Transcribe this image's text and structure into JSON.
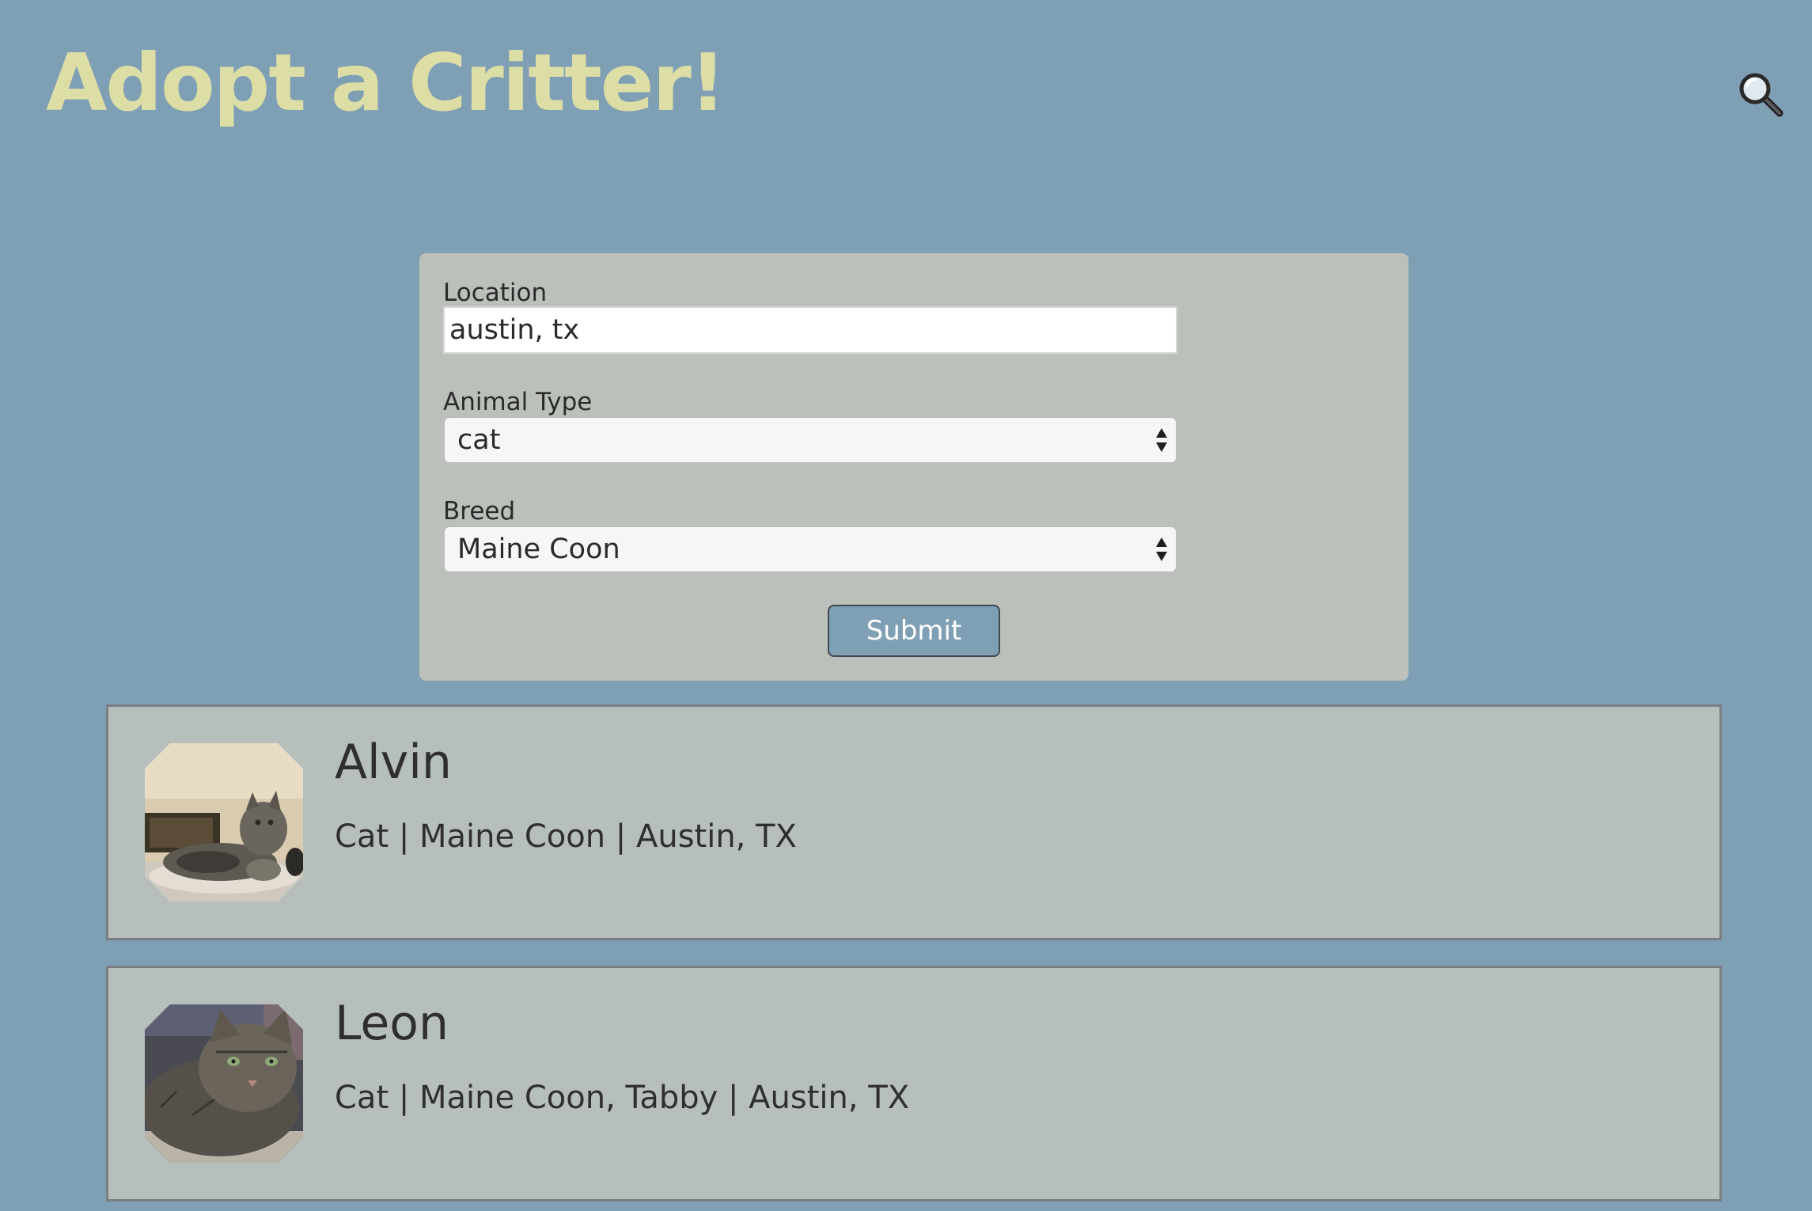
{
  "header": {
    "title": "Adopt a Critter!",
    "search_icon": "magnifying-glass-icon"
  },
  "search_form": {
    "location": {
      "label": "Location",
      "value": "austin, tx"
    },
    "animal_type": {
      "label": "Animal Type",
      "selected": "cat"
    },
    "breed": {
      "label": "Breed",
      "selected": "Maine Coon"
    },
    "submit_label": "Submit"
  },
  "results": [
    {
      "name": "Alvin",
      "details": "Cat | Maine Coon | Austin, TX"
    },
    {
      "name": "Leon",
      "details": "Cat | Maine Coon, Tabby | Austin, TX"
    }
  ],
  "colors": {
    "page_background": "#7f9fb4",
    "title": "#dcdea6",
    "form_background": "#bbc1ba",
    "card_background": "#b6bfbb",
    "submit_background": "#7f9fb4"
  }
}
